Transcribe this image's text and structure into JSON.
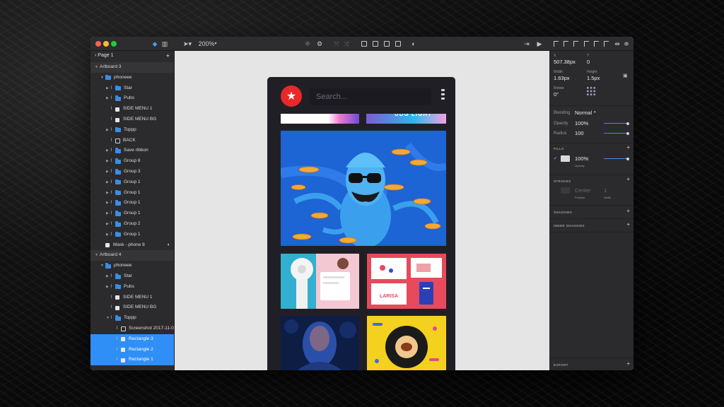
{
  "toolbar": {
    "zoom": "200%",
    "traffic_colors": [
      "#fe5f57",
      "#febc2e",
      "#28c840"
    ]
  },
  "layers": {
    "page_label": "Page 1",
    "add_label": "+",
    "rows": [
      {
        "name": "Artboard 3",
        "kind": "section",
        "indent": 0
      },
      {
        "name": "phoneee",
        "kind": "folder",
        "indent": 1,
        "open": true
      },
      {
        "name": "Star",
        "kind": "folder",
        "indent": 2
      },
      {
        "name": "Pubs",
        "kind": "folder",
        "indent": 2
      },
      {
        "name": "SIDE MENU 1",
        "kind": "shape",
        "indent": 2
      },
      {
        "name": "SIDE MENU BG",
        "kind": "shape",
        "indent": 2
      },
      {
        "name": "Toppp",
        "kind": "folder",
        "indent": 2
      },
      {
        "name": "BACK",
        "kind": "image",
        "indent": 2
      },
      {
        "name": "Save ribbon",
        "kind": "folder",
        "indent": 2
      },
      {
        "name": "Group 8",
        "kind": "folder",
        "indent": 2
      },
      {
        "name": "Group 3",
        "kind": "folder",
        "indent": 2
      },
      {
        "name": "Group 1",
        "kind": "folder",
        "indent": 2
      },
      {
        "name": "Group 1",
        "kind": "folder",
        "indent": 2
      },
      {
        "name": "Group 1",
        "kind": "folder",
        "indent": 2
      },
      {
        "name": "Group 1",
        "kind": "folder",
        "indent": 2
      },
      {
        "name": "Group 2",
        "kind": "folder",
        "indent": 2
      },
      {
        "name": "Group 1",
        "kind": "folder",
        "indent": 2
      },
      {
        "name": "Mask - phone 8",
        "kind": "mask",
        "indent": 1
      },
      {
        "name": "Artboard 4",
        "kind": "section",
        "indent": 0
      },
      {
        "name": "phoneee",
        "kind": "folder",
        "indent": 1,
        "open": true
      },
      {
        "name": "Star",
        "kind": "folder",
        "indent": 2
      },
      {
        "name": "Pubs",
        "kind": "folder",
        "indent": 2
      },
      {
        "name": "SIDE MENU 1",
        "kind": "shape",
        "indent": 2
      },
      {
        "name": "SIDE MENU BG",
        "kind": "shape",
        "indent": 2
      },
      {
        "name": "Toppp",
        "kind": "folder",
        "indent": 2,
        "open": true
      },
      {
        "name": "Screenshot 2017-11-0...",
        "kind": "image",
        "indent": 3
      },
      {
        "name": "Rectangle 3",
        "kind": "shape",
        "indent": 3,
        "selected": true
      },
      {
        "name": "Rectangle 2",
        "kind": "shape",
        "indent": 3,
        "selected": true
      },
      {
        "name": "Rectangle 1",
        "kind": "shape",
        "indent": 3,
        "selected": true
      }
    ]
  },
  "canvas": {
    "search_placeholder": "Search...",
    "accent": "#e8292a",
    "partial_text": "UDG LIGHT"
  },
  "inspector": {
    "x_label": "X",
    "x_value": "507.38px",
    "y_label": "Y",
    "y_value": "0",
    "width_label": "Width",
    "width_value": "1.63px",
    "height_label": "Height",
    "height_value": "1.5px",
    "rotate_label": "Rotate",
    "rotate_value": "0°",
    "blending_label": "Blending",
    "blending_value": "Normal",
    "opacity_label": "Opacity",
    "opacity_value": "100%",
    "radius_label": "Radius",
    "radius_value": "100",
    "fills_head": "FILLS",
    "fill_opacity_value": "100%",
    "fill_opacity_label": "Opacity",
    "fill_color": "#d9d9d9",
    "strokes_head": "STROKES",
    "stroke_position_value": "Center",
    "stroke_position_label": "Position",
    "stroke_width_value": "1",
    "stroke_width_label": "Width",
    "shadows_head": "SHADOWS",
    "inner_shadows_head": "INNER SHADOWS",
    "export_head": "EXPORT",
    "plus": "+"
  }
}
